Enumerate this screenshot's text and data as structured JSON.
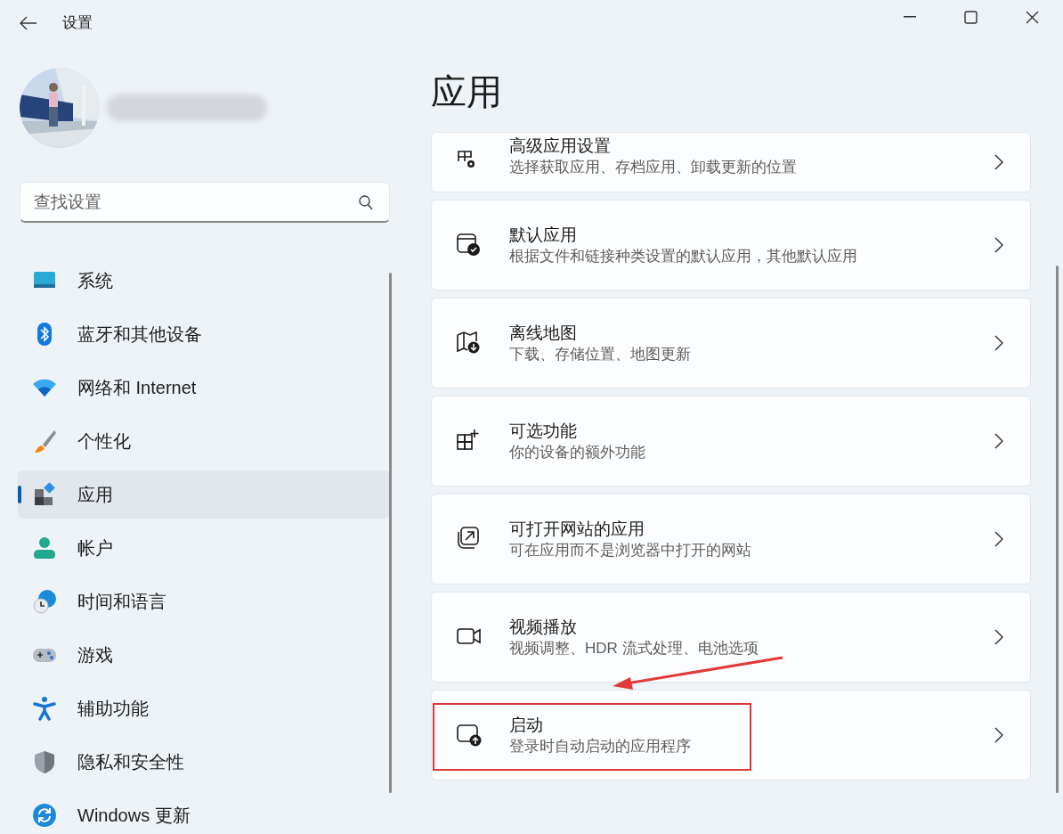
{
  "window": {
    "title": "设置"
  },
  "search": {
    "placeholder": "查找设置"
  },
  "nav": [
    {
      "label": "系统",
      "kind": "system",
      "selected": false
    },
    {
      "label": "蓝牙和其他设备",
      "kind": "bluetooth",
      "selected": false
    },
    {
      "label": "网络和 Internet",
      "kind": "network",
      "selected": false
    },
    {
      "label": "个性化",
      "kind": "brush",
      "selected": false
    },
    {
      "label": "应用",
      "kind": "apps",
      "selected": true
    },
    {
      "label": "帐户",
      "kind": "account",
      "selected": false
    },
    {
      "label": "时间和语言",
      "kind": "time",
      "selected": false
    },
    {
      "label": "游戏",
      "kind": "game",
      "selected": false
    },
    {
      "label": "辅助功能",
      "kind": "access",
      "selected": false
    },
    {
      "label": "隐私和安全性",
      "kind": "shield",
      "selected": false
    },
    {
      "label": "Windows 更新",
      "kind": "update",
      "selected": false
    }
  ],
  "page_title": "应用",
  "cards": [
    {
      "title": "高级应用设置",
      "subtitle": "选择获取应用、存档应用、卸载更新的位置",
      "kind": "advanced",
      "highlighted": false
    },
    {
      "title": "默认应用",
      "subtitle": "根据文件和链接种类设置的默认应用，其他默认应用",
      "kind": "default",
      "highlighted": false
    },
    {
      "title": "离线地图",
      "subtitle": "下载、存储位置、地图更新",
      "kind": "map",
      "highlighted": false
    },
    {
      "title": "可选功能",
      "subtitle": "你的设备的额外功能",
      "kind": "optional",
      "highlighted": false
    },
    {
      "title": "可打开网站的应用",
      "subtitle": "可在应用而不是浏览器中打开的网站",
      "kind": "web",
      "highlighted": false
    },
    {
      "title": "视频播放",
      "subtitle": "视频调整、HDR 流式处理、电池选项",
      "kind": "video",
      "highlighted": false
    },
    {
      "title": "启动",
      "subtitle": "登录时自动启动的应用程序",
      "kind": "startup",
      "highlighted": true
    }
  ]
}
